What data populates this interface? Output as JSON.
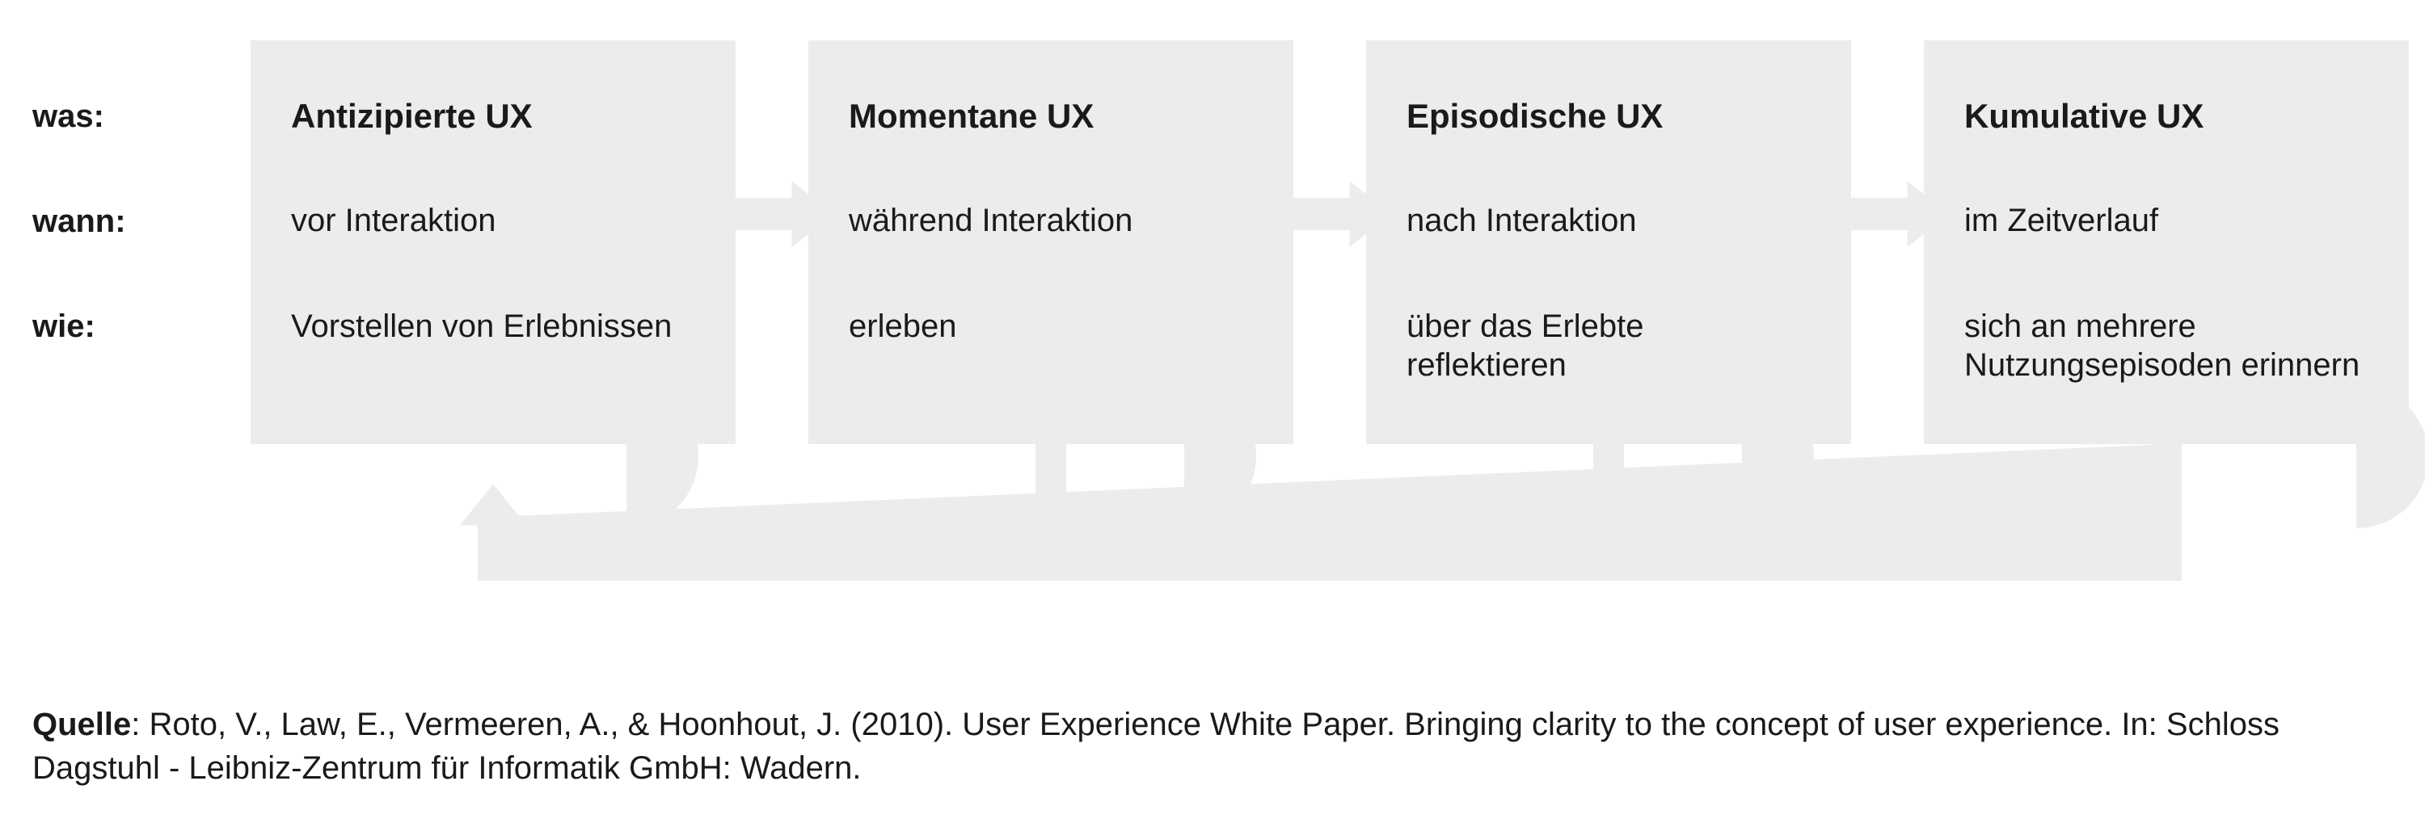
{
  "rowlabels": {
    "was": "was:",
    "wann": "wann:",
    "wie": "wie:"
  },
  "boxes": [
    {
      "title": "Antizipierte UX",
      "when": "vor Interaktion",
      "how": "Vorstellen von Erlebnissen"
    },
    {
      "title": "Momentane UX",
      "when": "während Interaktion",
      "how": "erleben"
    },
    {
      "title": "Episodische UX",
      "when": "nach Interaktion",
      "how": "über das Erlebte reflektieren"
    },
    {
      "title": "Kumulative UX",
      "when": "im Zeitverlauf",
      "how": "sich an mehrere Nutzungsepisoden erinnern"
    }
  ],
  "source": {
    "label": "Quelle",
    "text": ": Roto, V., Law, E., Vermeeren, A., & Hoonhout, J.  (2010). User Experience White Paper. Bringing clarity to the concept of user experience. In: Schloss Dagstuhl - Leibniz-Zentrum für Informatik GmbH: Wadern."
  },
  "colors": {
    "box_bg": "#ececec",
    "text": "#1a1a1a",
    "arrow": "#ececec"
  }
}
